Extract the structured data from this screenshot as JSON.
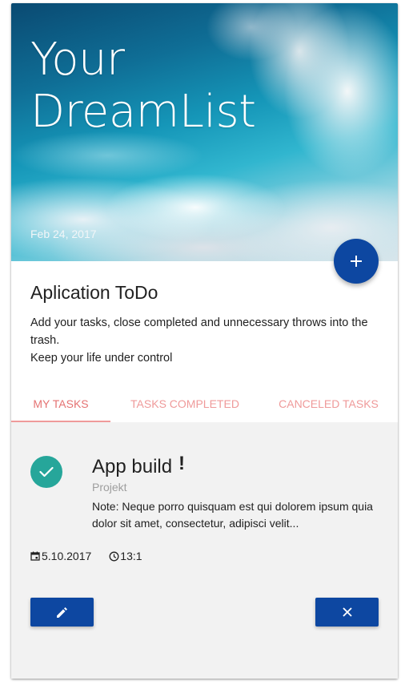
{
  "hero": {
    "title_line1": "Your",
    "title_line2": "DreamList",
    "date": "Feb 24, 2017"
  },
  "fab": {
    "label": "+",
    "icon": "plus-icon"
  },
  "intro": {
    "title": "Aplication ToDo",
    "description_line1": "Add your tasks, close completed and unnecessary throws into the trash.",
    "description_line2": "Keep your life under control"
  },
  "tabs": [
    {
      "label": "MY TASKS",
      "active": true
    },
    {
      "label": "TASKS COMPLETED",
      "active": false
    },
    {
      "label": "CANCELED TASKS",
      "active": false
    }
  ],
  "task": {
    "title": "App build",
    "priority_mark": "!",
    "category": "Projekt",
    "note": "Note: Neque porro quisquam est qui dolorem ipsum quia dolor sit amet, consectetur, adipisci velit...",
    "date": "5.10.2017",
    "time": "13:1",
    "status_icon": "check-icon",
    "date_icon": "calendar-icon",
    "time_icon": "clock-icon"
  },
  "actions": {
    "edit_icon": "pencil-icon",
    "delete_icon": "close-icon"
  },
  "colors": {
    "primary": "#0d47a1",
    "tab_text": "#ef9a9a",
    "check": "#26a69a",
    "panel_bg": "#f2f2f2"
  }
}
